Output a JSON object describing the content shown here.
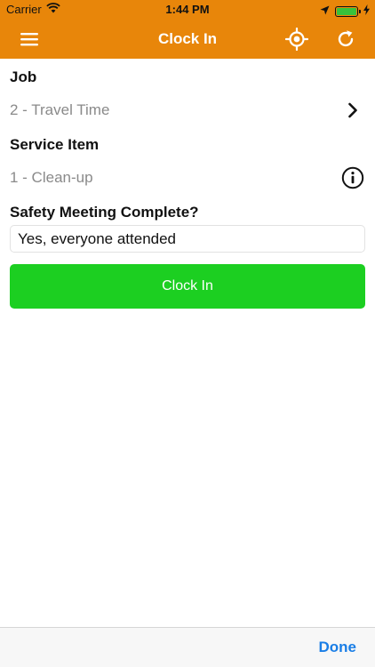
{
  "status_bar": {
    "carrier": "Carrier",
    "time": "1:44 PM",
    "battery_color": "#37c23b"
  },
  "nav": {
    "title": "Clock In",
    "background": "#e8860a",
    "left_icon": "hamburger-menu-icon",
    "right_icons": [
      "location-target-icon",
      "refresh-icon"
    ]
  },
  "form": {
    "job_label": "Job",
    "job_value": "2 - Travel Time",
    "service_label": "Service Item",
    "service_value": "1 - Clean-up",
    "safety_label": "Safety Meeting Complete?",
    "safety_value": "Yes, everyone attended"
  },
  "actions": {
    "clock_in_label": "Clock In",
    "clock_in_color": "#1ccf21"
  },
  "toolbar": {
    "done_label": "Done",
    "done_color": "#1a7ee6"
  }
}
